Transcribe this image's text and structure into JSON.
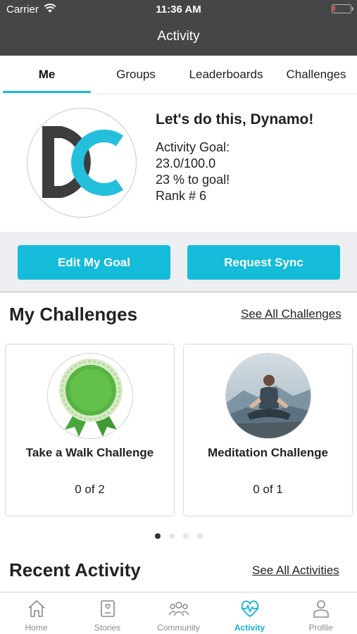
{
  "status_bar": {
    "carrier": "Carrier",
    "time": "11:36 AM"
  },
  "nav": {
    "title": "Activity"
  },
  "tabs": [
    {
      "label": "Me",
      "active": true
    },
    {
      "label": "Groups",
      "active": false
    },
    {
      "label": "Leaderboards",
      "active": false
    },
    {
      "label": "Challenges",
      "active": false
    }
  ],
  "profile": {
    "logo_text": "DC",
    "greeting": "Let's do this, Dynamo!",
    "goal_label": "Activity Goal:",
    "goal_value": "23.0/100.0",
    "percent_to_goal": "23 % to goal!",
    "rank": "Rank # 6"
  },
  "buttons": {
    "edit_goal": "Edit My Goal",
    "request_sync": "Request Sync"
  },
  "challenges": {
    "title": "My Challenges",
    "see_all": "See All Challenges",
    "cards": [
      {
        "title": "Take a Walk Challenge",
        "progress": "0 of 2",
        "image_icon": "green-ribbon-award-icon"
      },
      {
        "title": "Meditation Challenge",
        "progress": "0 of 1",
        "image_icon": "meditation-photo"
      }
    ],
    "page_count": 4,
    "active_page": 0
  },
  "recent": {
    "title": "Recent Activity",
    "see_all": "See All Activities"
  },
  "bottom_nav": [
    {
      "label": "Home",
      "icon": "home-icon",
      "active": false
    },
    {
      "label": "Stories",
      "icon": "stories-icon",
      "active": false
    },
    {
      "label": "Community",
      "icon": "community-icon",
      "active": false
    },
    {
      "label": "Activity",
      "icon": "activity-heart-icon",
      "active": true
    },
    {
      "label": "Profile",
      "icon": "profile-icon",
      "active": false
    }
  ],
  "colors": {
    "accent": "#14bcd9",
    "header_bg": "#464646",
    "logo_dark": "#3d3d3d",
    "logo_cyan": "#24bfdc",
    "inactive_icon": "#8a8a8a"
  }
}
